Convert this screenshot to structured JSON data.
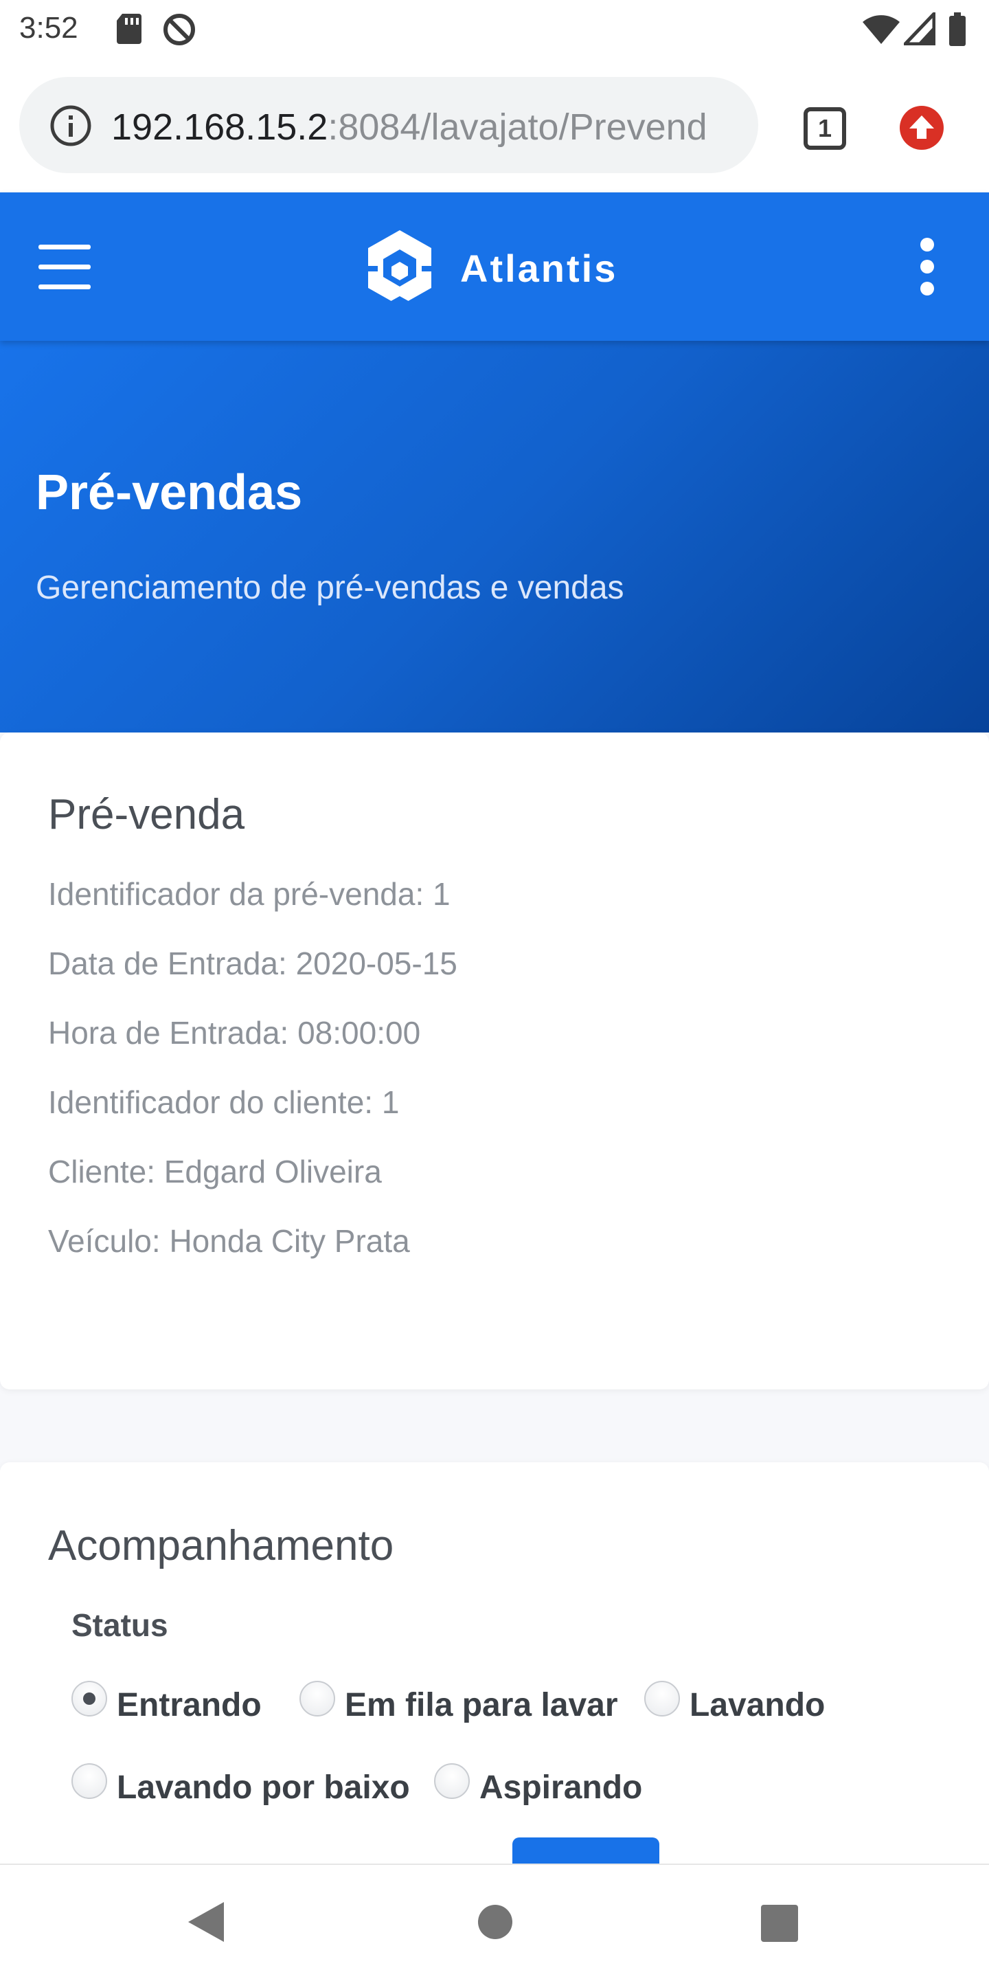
{
  "status_bar": {
    "time": "3:52",
    "icons": [
      "sd-card-icon",
      "do-not-disturb-icon",
      "wifi-icon",
      "cell-signal-icon",
      "battery-icon"
    ]
  },
  "browser": {
    "url_host": "192.168.15.2",
    "url_path": ":8084/lavajato/Prevend",
    "tab_count": "1",
    "icons": [
      "info-icon",
      "tab-switcher-icon",
      "update-icon"
    ]
  },
  "app": {
    "brand": "Atlantis",
    "brand_color": "#1872e8",
    "icons": [
      "hamburger-menu-icon",
      "atlantis-logo-icon",
      "more-vertical-icon"
    ]
  },
  "hero": {
    "title": "Pré-vendas",
    "subtitle": "Gerenciamento de pré-vendas e vendas"
  },
  "presale": {
    "title": "Pré-venda",
    "details": [
      "Identificador da pré-venda: 1",
      "Data de Entrada: 2020-05-15",
      "Hora de Entrada: 08:00:00",
      "Identificador do cliente: 1",
      "Cliente: Edgard Oliveira",
      "Veículo: Honda City Prata"
    ]
  },
  "tracking": {
    "title": "Acompanhamento",
    "status_label": "Status",
    "selected": "Entrando",
    "options": [
      "Entrando",
      "Em fila para lavar",
      "Lavando",
      "Lavando por baixo",
      "Aspirando"
    ]
  },
  "navigation": {
    "icons": [
      "back-icon",
      "home-icon",
      "recents-icon"
    ]
  }
}
